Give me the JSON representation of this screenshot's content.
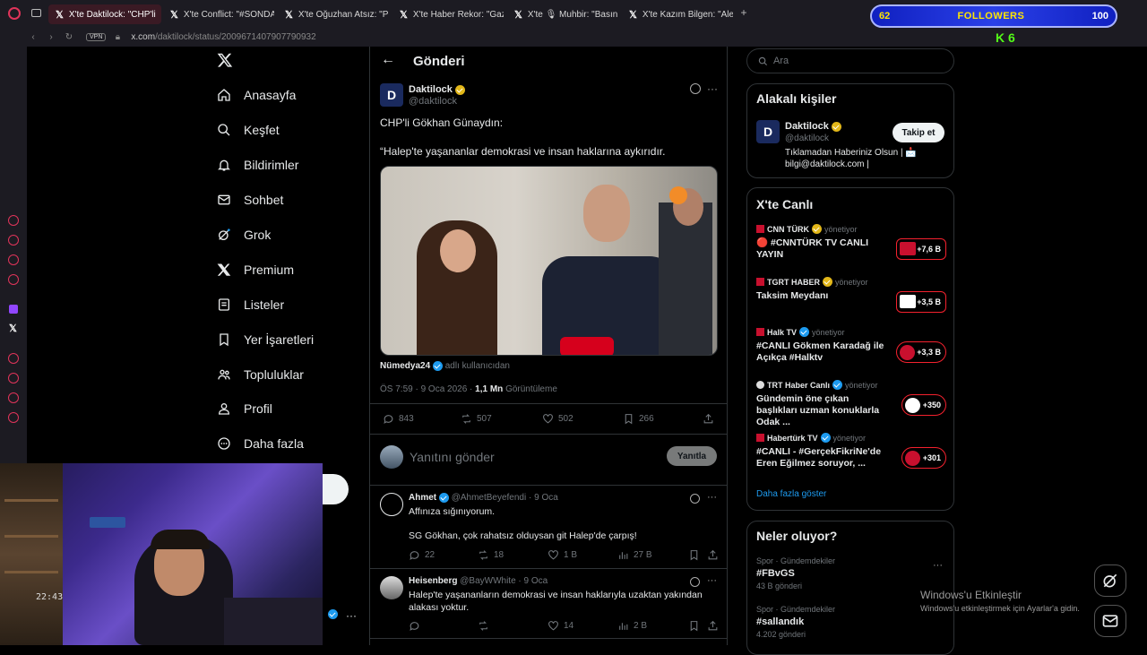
{
  "tabs": [
    {
      "label": "X'te Daktilock: \"CHP'li",
      "active": true
    },
    {
      "label": "X'te Conflict: \"#SONDAKİ"
    },
    {
      "label": "X'te Oğuzhan Atsız: \"Pijam"
    },
    {
      "label": "X'te Haber Rekor: \"Gazete"
    },
    {
      "label": "X'te 🎙 Muhbir: \"Basın me"
    },
    {
      "label": "X'te Kazım Bilgen: \"Alevile"
    }
  ],
  "browser": {
    "vpn": "VPN",
    "url_host": "x.com",
    "url_path": "/daktilock/status/2009671407907790932"
  },
  "overlay": {
    "left": "62",
    "label": "FOLLOWERS",
    "right": "100",
    "kick": "K 6"
  },
  "nav": {
    "items": [
      "Anasayfa",
      "Keşfet",
      "Bildirimler",
      "Sohbet",
      "Grok",
      "Premium",
      "Listeler",
      "Yer İşaretleri",
      "Topluluklar",
      "Profil",
      "Daha fazla"
    ]
  },
  "post": {
    "header": "Gönderi",
    "author": "Daktilock",
    "handle": "@daktilock",
    "text1": "CHP'li Gökhan Günaydın:",
    "text2": "“Halep'te yaşananlar demokrasi ve insan haklarına aykırıdır.",
    "media_credit_name": "Nümedya24",
    "media_credit_suffix": "adlı kullanıcıdan",
    "time": "ÖS 7:59 · 9 Oca 2026 ·",
    "views": "1,1 Mn",
    "views_label": "Görüntüleme",
    "stats": {
      "replies": "843",
      "reposts": "507",
      "likes": "502",
      "bookmarks": "266"
    },
    "reply_placeholder": "Yanıtını gönder",
    "reply_button": "Yanıtla"
  },
  "replies": [
    {
      "name": "Ahmet",
      "handle": "@AhmetBeyefendi",
      "date": "· 9 Oca",
      "line1": "Affınıza sığınıyorum.",
      "line2": "SG Gökhan, çok rahatsız olduysan git Halep'de çarpış!",
      "stats": {
        "replies": "22",
        "reposts": "18",
        "likes": "1 B",
        "views": "27 B"
      }
    },
    {
      "name": "Heisenberg",
      "handle": "@BayWWhite",
      "date": "· 9 Oca",
      "line1": "Halep'te yaşananların demokrasi ve insan haklarıyla uzaktan yakından alakası yoktur.",
      "stats": {
        "replies": "",
        "reposts": "",
        "likes": "14",
        "views": "2 B"
      }
    }
  ],
  "search": {
    "placeholder": "Ara"
  },
  "related": {
    "title": "Alakalı kişiler",
    "name": "Daktilock",
    "handle": "@daktilock",
    "bio": "Tıklamadan Haberiniz Olsun | 📩 bilgi@daktilock.com |",
    "follow": "Takip et"
  },
  "live": {
    "title": "X'te Canlı",
    "role": "yönetiyor",
    "items": [
      {
        "source": "CNN TÜRK",
        "title": "🔴 #CNNTÜRK TV CANLI YAYIN",
        "count": "+7,6 B"
      },
      {
        "source": "TGRT HABER",
        "title": "Taksim Meydanı",
        "count": "+3,5 B"
      },
      {
        "source": "Halk TV",
        "title": "#CANLI Gökmen Karadağ ile Açıkça #Halktv",
        "count": "+3,3 B"
      },
      {
        "source": "TRT Haber Canlı",
        "title": "Gündemin öne çıkan başlıkları uzman konuklarla Odak ...",
        "count": "+350"
      },
      {
        "source": "Habertürk TV",
        "title": "#CANLI - #GerçekFikriNe'de Eren Eğilmez soruyor, ...",
        "count": "+301"
      }
    ],
    "more": "Daha fazla göster"
  },
  "trends": {
    "title": "Neler oluyor?",
    "items": [
      {
        "category": "Spor · Gündemdekiler",
        "tag": "#FBvGS",
        "count": "43 B gönderi"
      },
      {
        "category": "Spor · Gündemdekiler",
        "tag": "#sallandık",
        "count": "4.202 gönderi"
      }
    ]
  },
  "watermark": {
    "title": "Windows'u Etkinleştir",
    "sub": "Windows'u etkinleştirmek için Ayarlar'a gidin."
  },
  "webcam": {
    "clock": "22:43"
  }
}
